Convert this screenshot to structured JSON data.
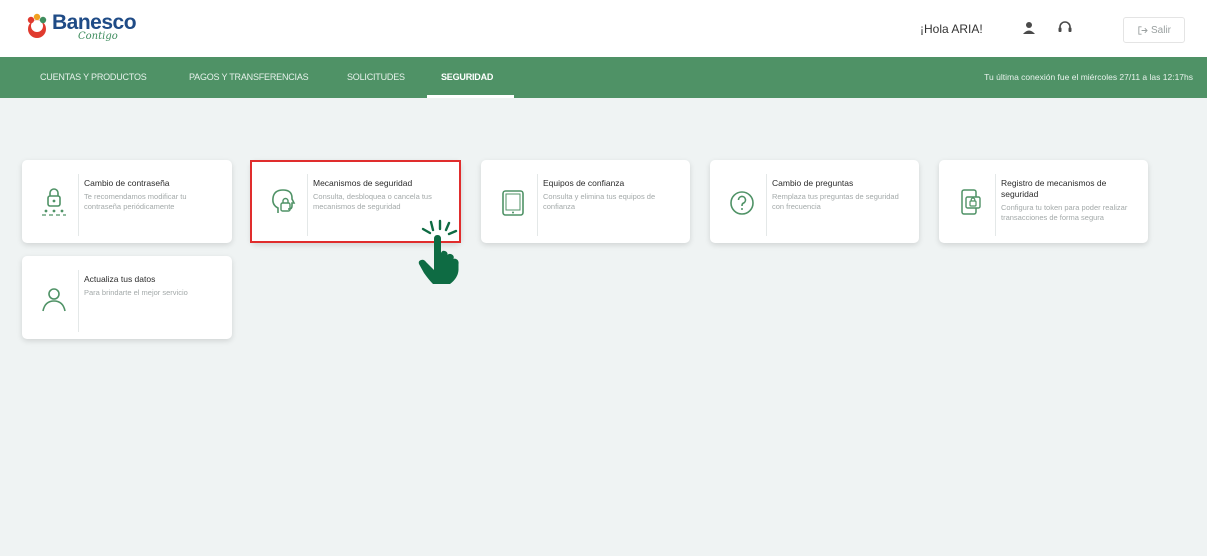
{
  "brand": {
    "name": "Banesco",
    "tagline": "Contigo",
    "accent": "#4f9266",
    "primary": "#1f4b86",
    "mark_color": "#e03a2e"
  },
  "header": {
    "greeting": "¡Hola ARIA!",
    "user_icon": "user-icon",
    "support_icon": "headset-icon",
    "logout_label": "Salir",
    "logout_icon": "logout-icon"
  },
  "nav": {
    "items": [
      {
        "label": "CUENTAS Y PRODUCTOS",
        "active": false
      },
      {
        "label": "PAGOS Y TRANSFERENCIAS",
        "active": false
      },
      {
        "label": "SOLICITUDES",
        "active": false
      },
      {
        "label": "SEGURIDAD",
        "active": true
      }
    ],
    "last_connection": "Tu última conexión fue el miércoles 27/11 a las 12:17hs"
  },
  "cards": [
    {
      "title": "Cambio de contraseña",
      "desc": "Te recomendamos modificar tu contraseña periódicamente",
      "icon": "lock-password-icon"
    },
    {
      "title": "Mecanismos de seguridad",
      "desc": "Consulta, desbloquea o cancela tus mecanismos de seguridad",
      "icon": "head-lock-icon",
      "highlighted": true
    },
    {
      "title": "Equipos de confianza",
      "desc": "Consulta y elimina tus equipos de confianza",
      "icon": "tablet-icon"
    },
    {
      "title": "Cambio de preguntas",
      "desc": "Remplaza tus preguntas de seguridad con frecuencia",
      "icon": "question-icon"
    },
    {
      "title": "Registro de mecanismos de seguridad",
      "desc": "Configura tu token para poder realizar transacciones de forma segura",
      "icon": "phone-lock-icon"
    },
    {
      "title": "Actualiza tus datos",
      "desc": "Para brindarte el mejor servicio",
      "icon": "user-outline-icon"
    }
  ],
  "pointer": {
    "icon": "hand-pointer-icon",
    "color": "#0e6b43"
  }
}
